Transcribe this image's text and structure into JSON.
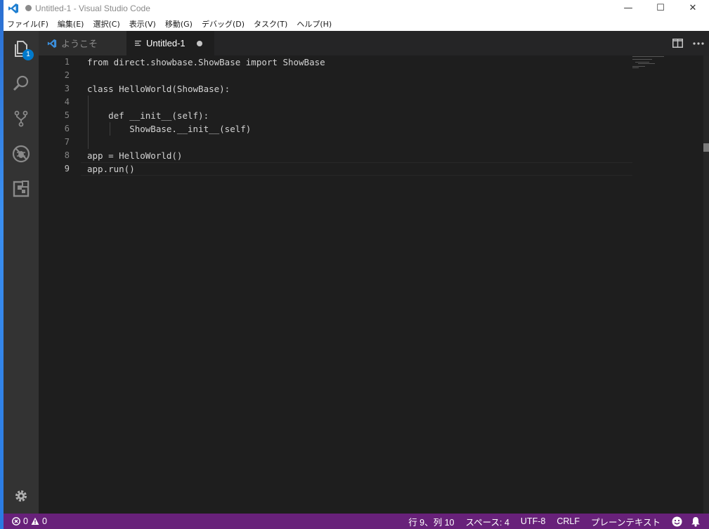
{
  "window": {
    "title": "Untitled-1 - Visual Studio Code",
    "controls": {
      "minimize": "—",
      "maximize": "☐",
      "close": "✕"
    }
  },
  "menubar": {
    "items": [
      "ファイル(F)",
      "編集(E)",
      "選択(C)",
      "表示(V)",
      "移動(G)",
      "デバッグ(D)",
      "タスク(T)",
      "ヘルプ(H)"
    ]
  },
  "activitybar": {
    "explorer_badge": "1",
    "icons": [
      "files-icon",
      "search-icon",
      "source-control-icon",
      "debug-icon",
      "extensions-icon",
      "settings-gear-icon"
    ]
  },
  "tabs": [
    {
      "label": "ようこそ",
      "active": false
    },
    {
      "label": "Untitled-1",
      "active": true,
      "dirty": true
    }
  ],
  "editor": {
    "line_numbers": [
      "1",
      "2",
      "3",
      "4",
      "5",
      "6",
      "7",
      "8",
      "9"
    ],
    "lines": [
      "from direct.showbase.ShowBase import ShowBase",
      "",
      "class HelloWorld(ShowBase):",
      "",
      "    def __init__(self):",
      "        ShowBase.__init__(self)",
      "",
      "app = HelloWorld()",
      "app.run()"
    ],
    "current_line": 9
  },
  "statusbar": {
    "errors": "0",
    "warnings": "0",
    "position": "行 9、列 10",
    "spaces": "スペース: 4",
    "encoding": "UTF-8",
    "eol": "CRLF",
    "language": "プレーンテキスト"
  },
  "colors": {
    "statusbar": "#68217a",
    "activitybar": "#333333",
    "editor_bg": "#1e1e1e",
    "badge": "#007acc"
  }
}
